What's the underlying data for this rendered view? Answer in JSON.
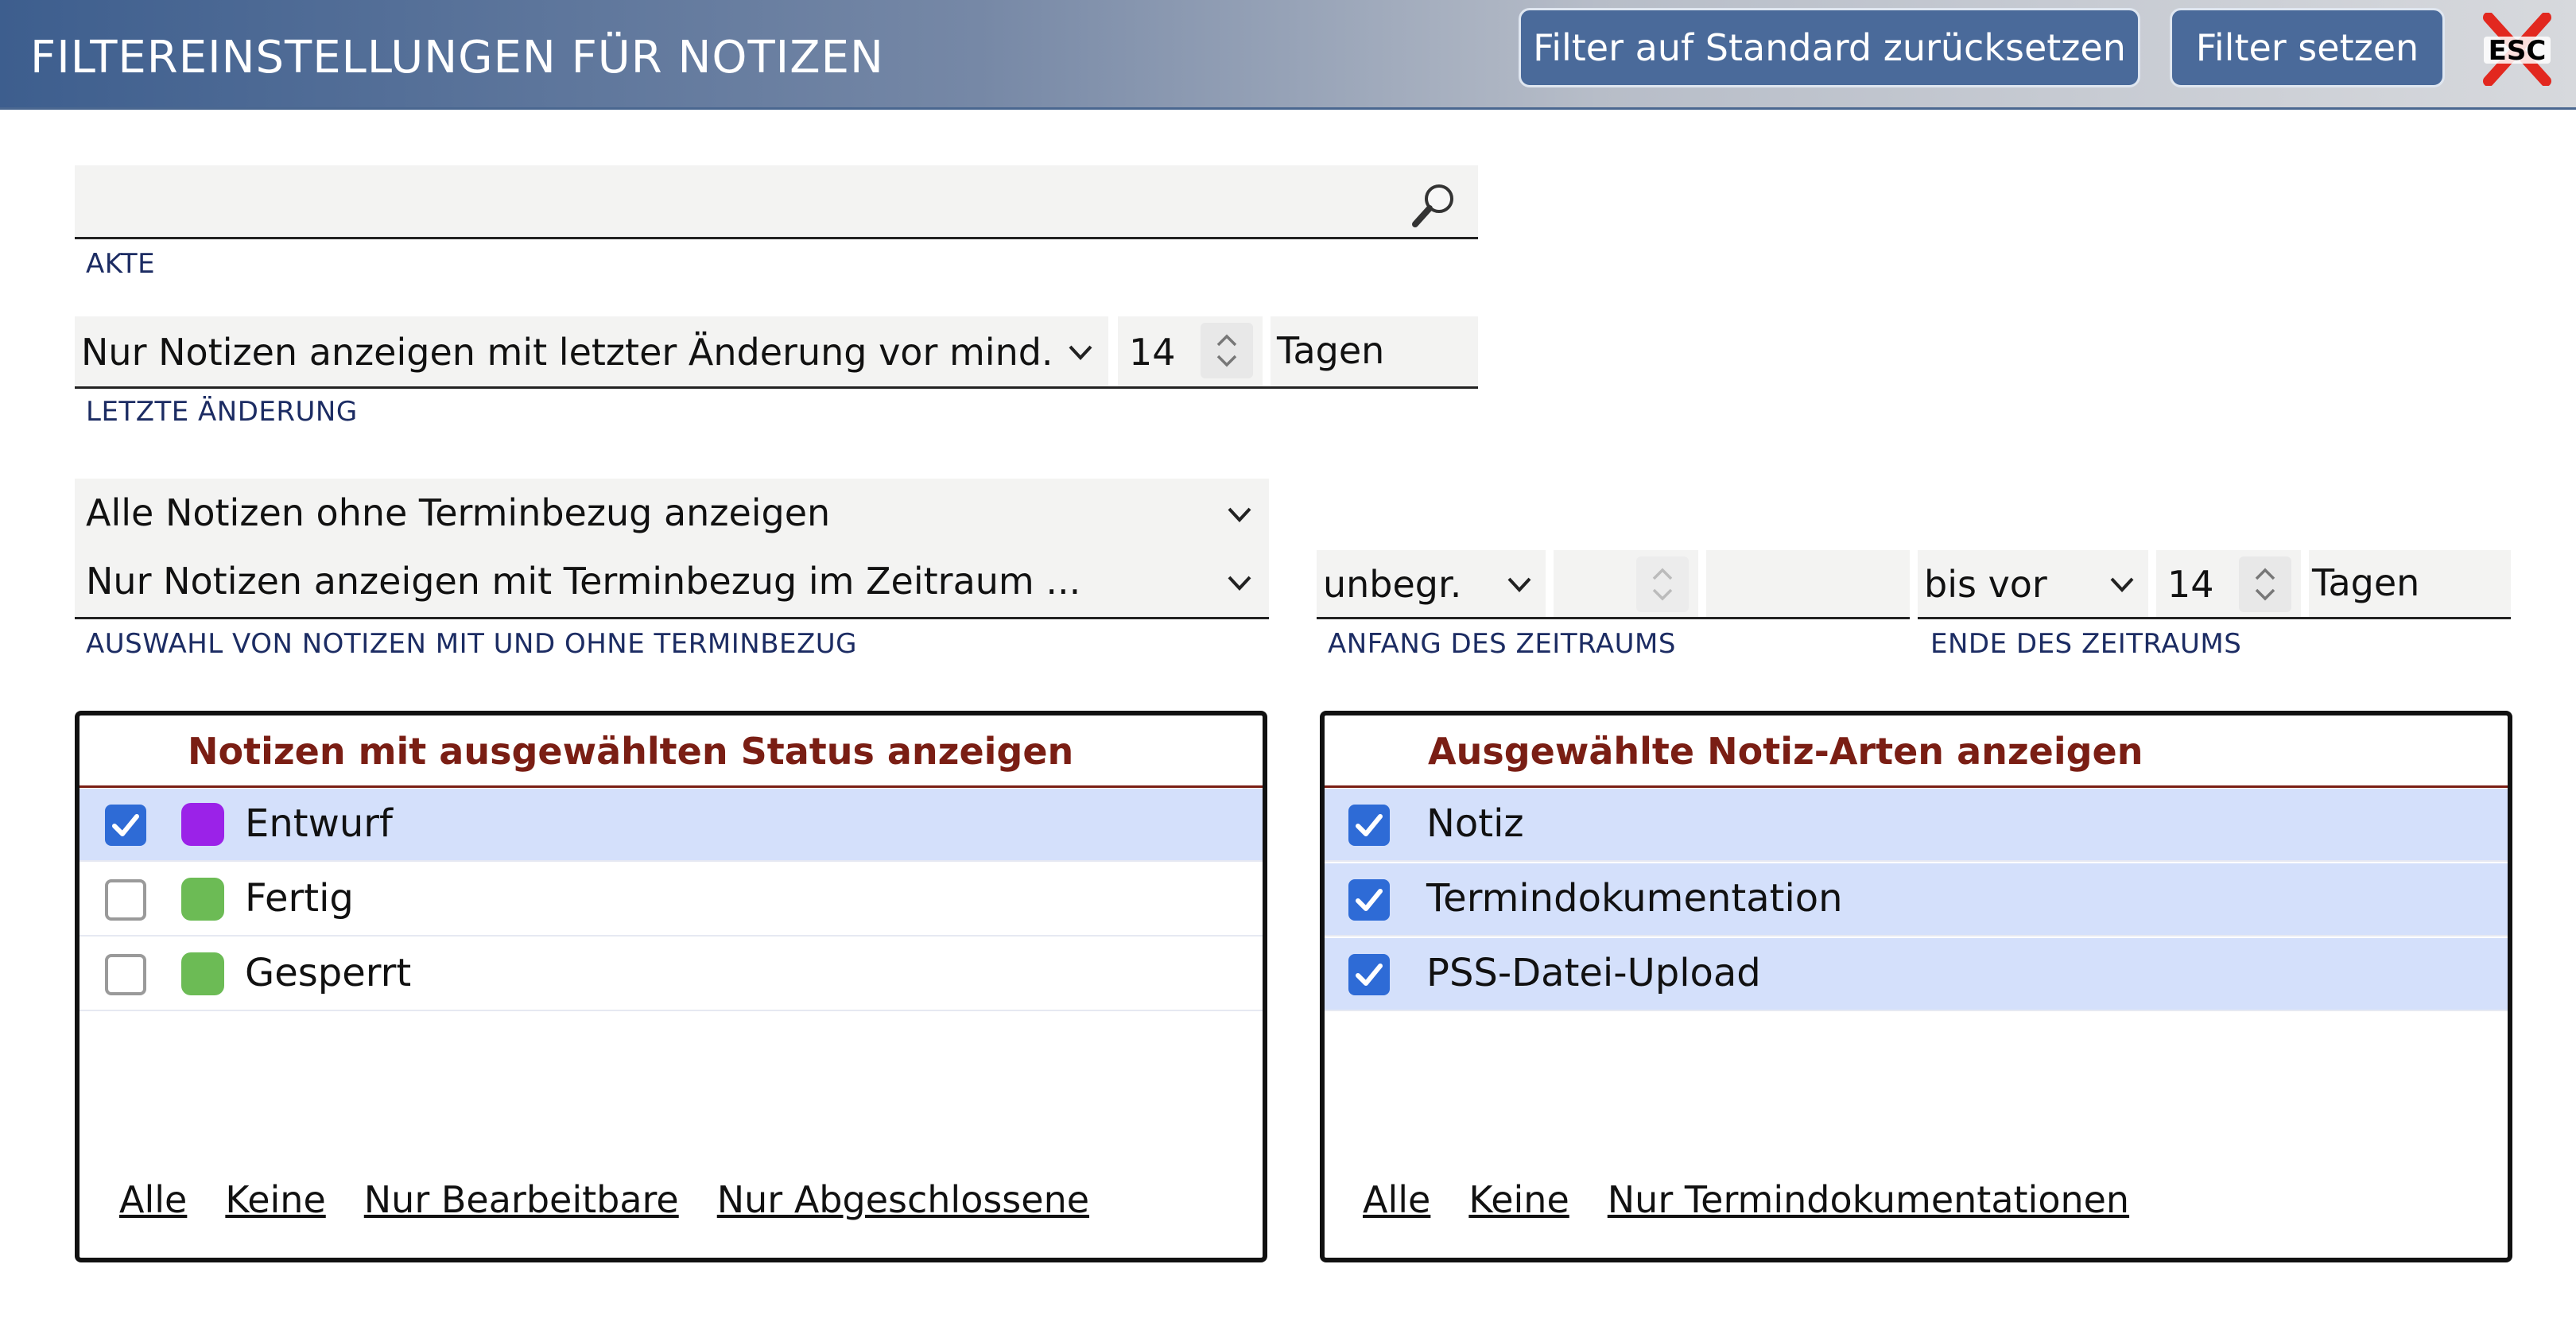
{
  "header": {
    "title": "FILTEREINSTELLUNGEN FÜR NOTIZEN",
    "reset_label": "Filter auf Standard zurücksetzen",
    "set_label": "Filter setzen",
    "esc_label": "ESC"
  },
  "akte": {
    "value": "",
    "caption": "AKTE"
  },
  "letzte_aenderung": {
    "select_value": "Nur Notizen anzeigen mit letzter Änderung vor mind.",
    "days": "14",
    "unit": "Tagen",
    "caption": "LETZTE ÄNDERUNG"
  },
  "terminbezug": {
    "option_ohne": "Alle Notizen ohne Terminbezug anzeigen",
    "option_mit": "Nur Notizen anzeigen mit Terminbezug im Zeitraum ...",
    "caption": "AUSWAHL VON NOTIZEN MIT UND OHNE TERMINBEZUG"
  },
  "zeitraum_anfang": {
    "select_value": "unbegr.",
    "number": "",
    "caption": "ANFANG DES ZEITRAUMS"
  },
  "zeitraum_ende": {
    "select_value": "bis vor",
    "number": "14",
    "unit": "Tagen",
    "caption": "ENDE DES ZEITRAUMS"
  },
  "status_panel": {
    "title": "Notizen mit ausgewählten Status anzeigen",
    "items": [
      {
        "label": "Entwurf",
        "checked": true,
        "color": "#9b22e8"
      },
      {
        "label": "Fertig",
        "checked": false,
        "color": "#6cbb55"
      },
      {
        "label": "Gesperrt",
        "checked": false,
        "color": "#6cbb55"
      }
    ],
    "links": [
      "Alle",
      "Keine",
      "Nur Bearbeitbare",
      "Nur Abgeschlossene"
    ]
  },
  "arten_panel": {
    "title": "Ausgewählte Notiz-Arten anzeigen",
    "items": [
      {
        "label": "Notiz",
        "checked": true
      },
      {
        "label": "Termindokumentation",
        "checked": true
      },
      {
        "label": "PSS-Datei-Upload",
        "checked": true
      }
    ],
    "links": [
      "Alle",
      "Keine",
      "Nur Termindokumentationen"
    ]
  },
  "colors": {
    "accent_blue": "#2e6bd6",
    "title_red": "#7a1e14",
    "selected_row": "#d4e0fb"
  }
}
